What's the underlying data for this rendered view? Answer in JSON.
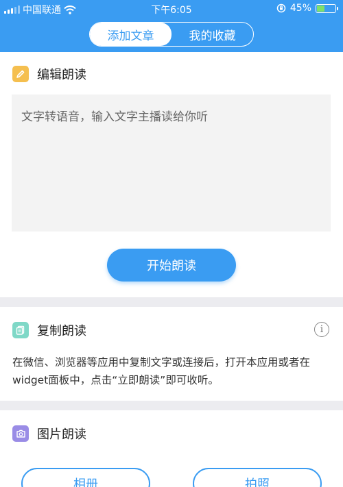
{
  "status_bar": {
    "carrier": "中国联通",
    "time": "下午6:05",
    "battery": "45%",
    "battery_level": 0.45
  },
  "tabs": [
    {
      "label": "添加文章",
      "active": true
    },
    {
      "label": "我的收藏",
      "active": false
    }
  ],
  "edit_section": {
    "title": "编辑朗读",
    "icon": "pencil-icon",
    "placeholder": "文字转语音，输入文字主播读给你听",
    "button": "开始朗读"
  },
  "copy_section": {
    "title": "复制朗读",
    "icon": "copy-doc-icon",
    "info_icon": "info-icon",
    "description": "在微信、浏览器等应用中复制文字或连接后，打开本应用或者在widget面板中，点击“立即朗读”即可收听。"
  },
  "image_section": {
    "title": "图片朗读",
    "icon": "camera-icon",
    "buttons": [
      "相册",
      "拍照"
    ]
  },
  "colors": {
    "primary": "#3a9cf2",
    "edit_icon": "#f5bf4f",
    "copy_icon": "#7fd8c7",
    "image_icon": "#9a8ce6"
  }
}
